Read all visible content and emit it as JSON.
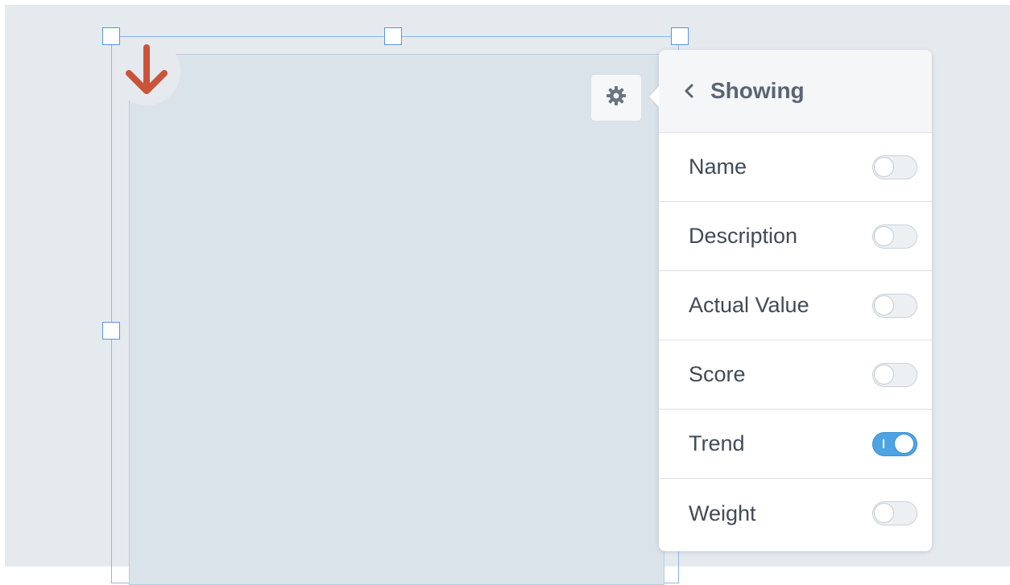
{
  "icons": {
    "trend": "arrow-down-icon",
    "settings": "gear-icon",
    "back": "chevron-left-icon"
  },
  "colors": {
    "trend_arrow": "#c9543a",
    "toggle_on": "#4ea4e3",
    "handle_border": "#5b93e0"
  },
  "popover": {
    "title": "Showing",
    "options": [
      {
        "label": "Name",
        "enabled": false
      },
      {
        "label": "Description",
        "enabled": false
      },
      {
        "label": "Actual Value",
        "enabled": false
      },
      {
        "label": "Score",
        "enabled": false
      },
      {
        "label": "Trend",
        "enabled": true
      },
      {
        "label": "Weight",
        "enabled": false
      }
    ]
  }
}
